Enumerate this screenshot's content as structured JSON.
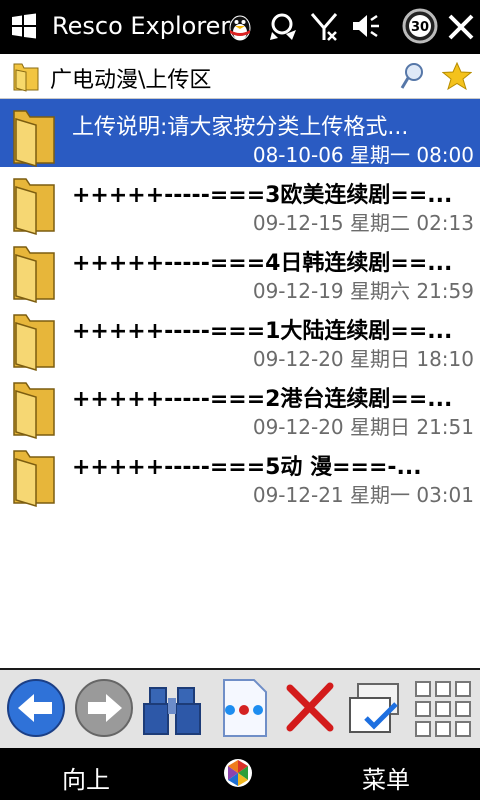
{
  "status": {
    "app_title": "Resco Explorer",
    "icons": [
      "windows-logo",
      "qq-penguin-icon",
      "sync-icon",
      "no-signal-icon",
      "volume-icon",
      "battery-30-icon",
      "close-icon"
    ],
    "battery_badge": "30"
  },
  "path": {
    "text": "广电动漫\\上传区",
    "icons": [
      "folder-icon",
      "search-icon",
      "favorite-star-icon"
    ]
  },
  "files": [
    {
      "name": "上传说明:请大家按分类上传格式...",
      "date": "08-10-06 星期一 08:00",
      "selected": true
    },
    {
      "name": "+++++-----===3欧美连续剧==...",
      "date": "09-12-15 星期二 02:13",
      "selected": false
    },
    {
      "name": "+++++-----===4日韩连续剧==...",
      "date": "09-12-19 星期六 21:59",
      "selected": false
    },
    {
      "name": "+++++-----===1大陆连续剧==...",
      "date": "09-12-20 星期日 18:10",
      "selected": false
    },
    {
      "name": "+++++-----===2港台连续剧==...",
      "date": "09-12-20 星期日 21:51",
      "selected": false
    },
    {
      "name": "+++++-----===5动      漫===-...",
      "date": "09-12-21 星期一 03:01",
      "selected": false
    }
  ],
  "toolbar": [
    "back-arrow-icon",
    "forward-arrow-icon",
    "binoculars-icon",
    "properties-icon",
    "delete-icon",
    "multiselect-icon",
    "view-grid-icon"
  ],
  "softkeys": {
    "left": "向上",
    "right": "菜单",
    "center_icon": "start-menu-icon"
  },
  "colors": {
    "selection": "#2a5bc2",
    "folder": "#f2c542",
    "bar": "#000000"
  }
}
